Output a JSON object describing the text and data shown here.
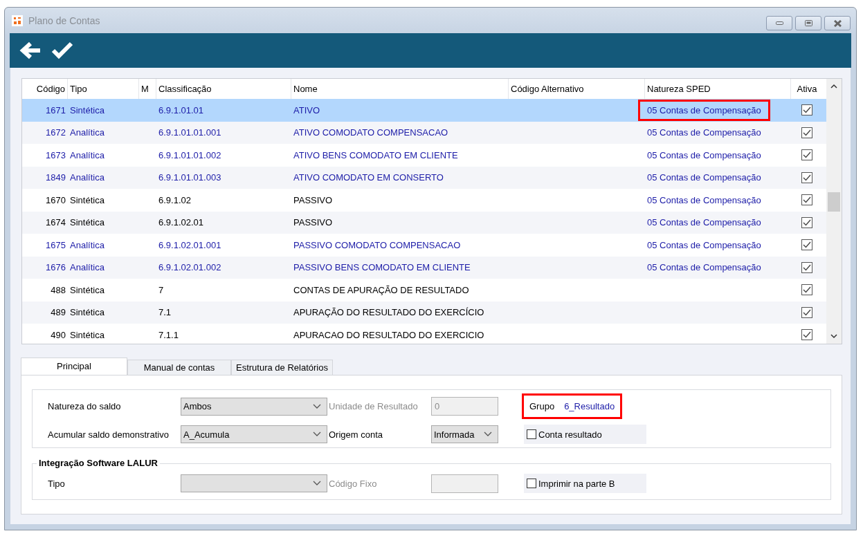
{
  "window": {
    "title": "Plano de Contas"
  },
  "table": {
    "columns": [
      "Código",
      "Tipo",
      "M",
      "Classificação",
      "Nome",
      "Código Alternativo",
      "Natureza SPED",
      "Ativa"
    ],
    "rows": [
      {
        "codigo": "1671",
        "tipo": "Sintética",
        "classificacao": "6.9.1.01.01",
        "nome": "ATIVO",
        "natureza_sped": "05 Contas de Compensação",
        "sped_highlighted": true,
        "ativa": true,
        "selected": true,
        "color": "#1c1ca8"
      },
      {
        "codigo": "1672",
        "tipo": "Analítica",
        "classificacao": "6.9.1.01.01.001",
        "nome": "ATIVO COMODATO COMPENSACAO",
        "natureza_sped": "05 Contas de Compensação",
        "sped_highlighted": false,
        "ativa": true,
        "selected": false,
        "color": "#1c1ca8"
      },
      {
        "codigo": "1673",
        "tipo": "Analítica",
        "classificacao": "6.9.1.01.01.002",
        "nome": "ATIVO BENS COMODATO EM CLIENTE",
        "natureza_sped": "05 Contas de Compensação",
        "sped_highlighted": false,
        "ativa": true,
        "selected": false,
        "color": "#1c1ca8"
      },
      {
        "codigo": "1849",
        "tipo": "Analítica",
        "classificacao": "6.9.1.01.01.003",
        "nome": "ATIVO COMODATO EM CONSERTO",
        "natureza_sped": "05 Contas de Compensação",
        "sped_highlighted": false,
        "ativa": true,
        "selected": false,
        "color": "#1c1ca8"
      },
      {
        "codigo": "1670",
        "tipo": "Sintética",
        "classificacao": "6.9.1.02",
        "nome": "PASSIVO",
        "natureza_sped": "05 Contas de Compensação",
        "sped_highlighted": false,
        "ativa": true,
        "selected": false,
        "color": "#000000"
      },
      {
        "codigo": "1674",
        "tipo": "Sintética",
        "classificacao": "6.9.1.02.01",
        "nome": "PASSIVO",
        "natureza_sped": "05 Contas de Compensação",
        "sped_highlighted": false,
        "ativa": true,
        "selected": false,
        "color": "#000000"
      },
      {
        "codigo": "1675",
        "tipo": "Analítica",
        "classificacao": "6.9.1.02.01.001",
        "nome": "PASSIVO COMODATO COMPENSACAO",
        "natureza_sped": "05 Contas de Compensação",
        "sped_highlighted": false,
        "ativa": true,
        "selected": false,
        "color": "#1c1ca8"
      },
      {
        "codigo": "1676",
        "tipo": "Analítica",
        "classificacao": "6.9.1.02.01.002",
        "nome": "PASSIVO BENS COMODATO EM CLIENTE",
        "natureza_sped": "05 Contas de Compensação",
        "sped_highlighted": false,
        "ativa": true,
        "selected": false,
        "color": "#1c1ca8"
      },
      {
        "codigo": "488",
        "tipo": "Sintética",
        "classificacao": "7",
        "nome": "CONTAS DE APURAÇÃO DE RESULTADO",
        "ativa": true,
        "selected": false,
        "color": "#000000"
      },
      {
        "codigo": "489",
        "tipo": "Sintética",
        "classificacao": "7.1",
        "nome": "APURAÇÃO DO RESULTADO DO EXERCÍCIO",
        "ativa": true,
        "selected": false,
        "color": "#000000"
      },
      {
        "codigo": "490",
        "tipo": "Sintética",
        "classificacao": "7.1.1",
        "nome": "APURACAO DO RESULTADO DO EXERCICIO",
        "ativa": true,
        "selected": false,
        "color": "#000000"
      }
    ]
  },
  "tabs": [
    {
      "label": "Principal",
      "selected": true
    },
    {
      "label": "Manual de contas",
      "selected": false
    },
    {
      "label": "Estrutura de Relatórios",
      "selected": false
    }
  ],
  "principal": {
    "natureza_do_saldo": {
      "label": "Natureza do saldo",
      "value": "Ambos"
    },
    "acumular_saldo": {
      "label": "Acumular saldo demonstrativo",
      "value": "A_Acumula"
    },
    "unidade_de_resultado": {
      "label": "Unidade de Resultado",
      "value": "0",
      "disabled": true
    },
    "origem_conta": {
      "label": "Origem conta",
      "value": "Informada"
    },
    "grupo": {
      "label": "Grupo",
      "value": "6_Resultado",
      "highlighted": true
    },
    "conta_resultado": {
      "label": "Conta resultado",
      "checked": false
    },
    "lalur": {
      "title": "Integração Software LALUR",
      "tipo": {
        "label": "Tipo"
      },
      "codigo_fixo": {
        "label": "Código Fixo",
        "disabled": true
      },
      "imprimir": {
        "label": "Imprimir na parte B",
        "checked": false
      }
    }
  }
}
